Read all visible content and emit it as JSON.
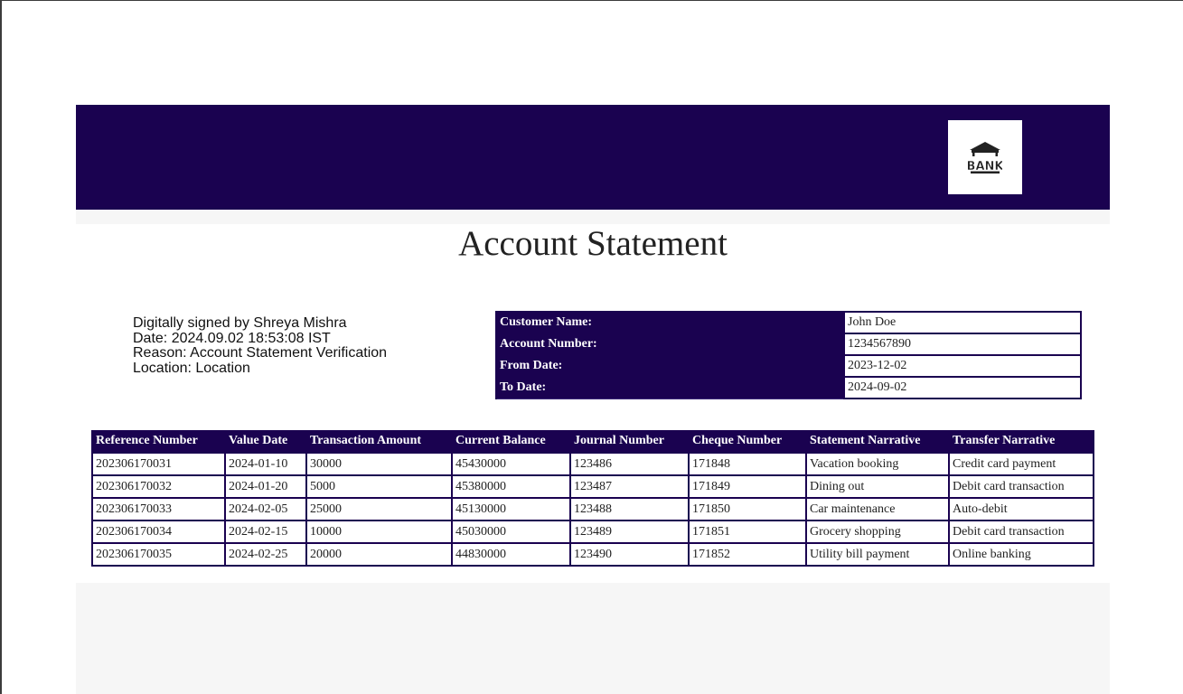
{
  "header": {
    "logo_text": "BANK",
    "brand_color": "#1a0250"
  },
  "title": "Account Statement",
  "signature": {
    "line1": "Digitally signed by Shreya Mishra",
    "line2": "Date: 2024.09.02 18:53:08 IST",
    "line3": "Reason: Account Statement Verification",
    "line4": "Location: Location"
  },
  "info": {
    "rows": [
      {
        "label": "Customer Name:",
        "value": "John Doe"
      },
      {
        "label": "Account Number:",
        "value": "1234567890"
      },
      {
        "label": "From Date:",
        "value": "2023-12-02"
      },
      {
        "label": "To Date:",
        "value": "2024-09-02"
      }
    ]
  },
  "transactions": {
    "headers": [
      "Reference Number",
      "Value Date",
      "Transaction Amount",
      "Current Balance",
      "Journal Number",
      "Cheque Number",
      "Statement Narrative",
      "Transfer Narrative"
    ],
    "rows": [
      [
        "202306170031",
        "2024-01-10",
        "30000",
        "45430000",
        "123486",
        "171848",
        "Vacation booking",
        "Credit card payment"
      ],
      [
        "202306170032",
        "2024-01-20",
        "5000",
        "45380000",
        "123487",
        "171849",
        "Dining out",
        "Debit card transaction"
      ],
      [
        "202306170033",
        "2024-02-05",
        "25000",
        "45130000",
        "123488",
        "171850",
        "Car maintenance",
        "Auto-debit"
      ],
      [
        "202306170034",
        "2024-02-15",
        "10000",
        "45030000",
        "123489",
        "171851",
        "Grocery shopping",
        "Debit card transaction"
      ],
      [
        "202306170035",
        "2024-02-25",
        "20000",
        "44830000",
        "123490",
        "171852",
        "Utility bill payment",
        "Online banking"
      ]
    ]
  }
}
